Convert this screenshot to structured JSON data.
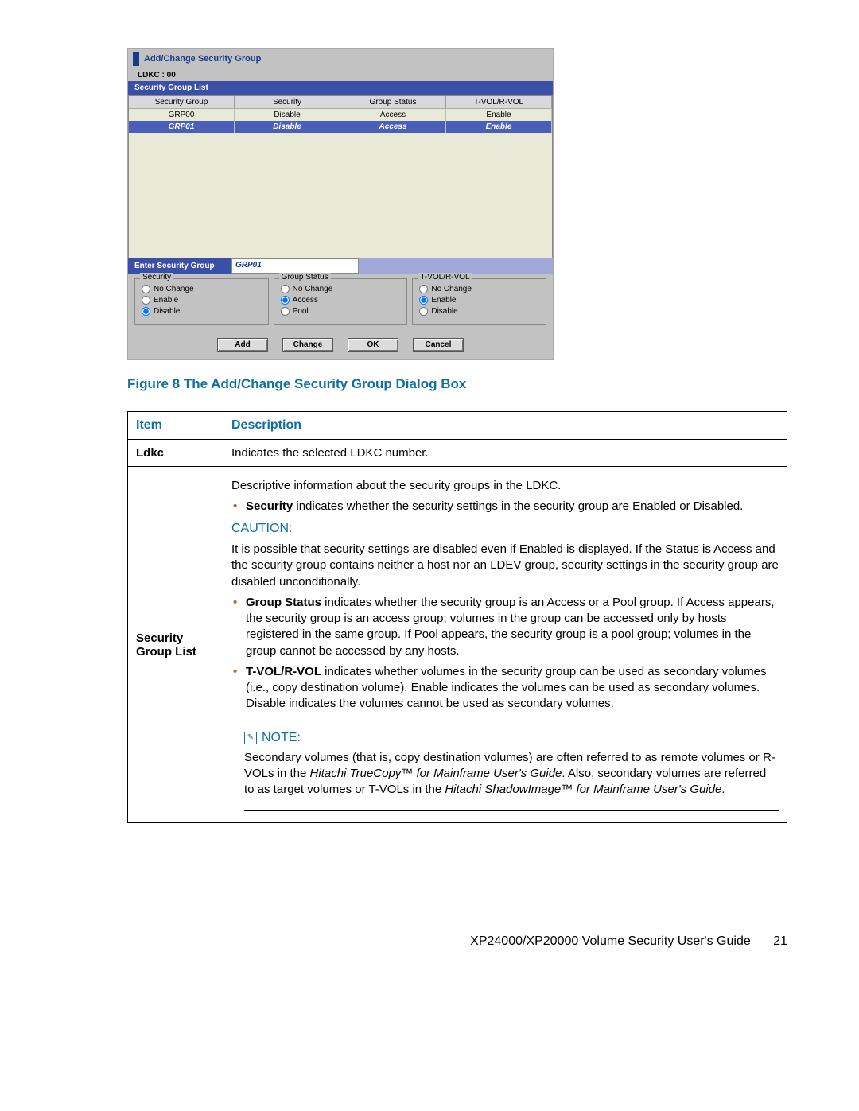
{
  "dialog": {
    "title": "Add/Change Security Group",
    "ldkc_label": "LDKC : 00",
    "list_bar": "Security Group List",
    "columns": {
      "c1": "Security Group",
      "c2": "Security",
      "c3": "Group Status",
      "c4": "T-VOL/R-VOL"
    },
    "rows": [
      {
        "group": "GRP00",
        "security": "Disable",
        "status": "Access",
        "tvol": "Enable",
        "selected": false
      },
      {
        "group": "GRP01",
        "security": "Disable",
        "status": "Access",
        "tvol": "Enable",
        "selected": true
      }
    ],
    "enter_label": "Enter Security Group",
    "enter_value": "GRP01",
    "radio_groups": {
      "security": {
        "legend": "Security",
        "opts": [
          "No Change",
          "Enable",
          "Disable"
        ],
        "selected": "Disable"
      },
      "group_status": {
        "legend": "Group Status",
        "opts": [
          "No Change",
          "Access",
          "Pool"
        ],
        "selected": "Access"
      },
      "tvol": {
        "legend": "T-VOL/R-VOL",
        "opts": [
          "No Change",
          "Enable",
          "Disable"
        ],
        "selected": "Enable"
      }
    },
    "buttons": {
      "add": "Add",
      "change": "Change",
      "ok": "OK",
      "cancel": "Cancel"
    }
  },
  "caption": "Figure 8 The Add/Change Security Group Dialog Box",
  "table": {
    "head": {
      "item": "Item",
      "desc": "Description"
    },
    "rows": {
      "ldkc": {
        "label": "Ldkc",
        "text": "Indicates the selected LDKC number."
      },
      "secgrp": {
        "label": "Security Group List",
        "intro": "Descriptive information about the security groups in the LDKC.",
        "b1_pre": "Security",
        "b1_rest": " indicates whether the security settings in the security group are Enabled or Disabled.",
        "caution_label": "CAUTION:",
        "caution_text": "It is possible that security settings are disabled even if Enabled is displayed. If the Status is Access and the security group contains neither a host nor an LDEV group, security settings in the security group are disabled unconditionally.",
        "b2_pre": "Group Status",
        "b2_rest": " indicates whether the security group is an Access or a Pool group. If Access appears, the security group is an access group; volumes in the group can be accessed only by hosts registered in the same group. If Pool appears, the security group is a pool group; volumes in the group cannot be accessed by any hosts.",
        "b3_pre": "T-VOL/R-VOL",
        "b3_rest": " indicates whether volumes in the security group can be used as secondary volumes (i.e., copy destination volume). Enable indicates the volumes can be used as secondary volumes. Disable indicates the volumes cannot be used as secondary volumes.",
        "note_label": "NOTE:",
        "note_p1a": "Secondary volumes (that is, copy destination volumes) are often referred to as remote volumes or R-VOLs in the ",
        "note_p1b": "Hitachi TrueCopy™ for Mainframe User's Guide",
        "note_p1c": ". Also, secondary volumes are referred to as target volumes or T-VOLs in the ",
        "note_p1d": "Hitachi ShadowImage™ for Mainframe User's Guide",
        "note_p1e": "."
      }
    }
  },
  "footer": {
    "guide": "XP24000/XP20000 Volume Security User's Guide",
    "page": "21"
  }
}
